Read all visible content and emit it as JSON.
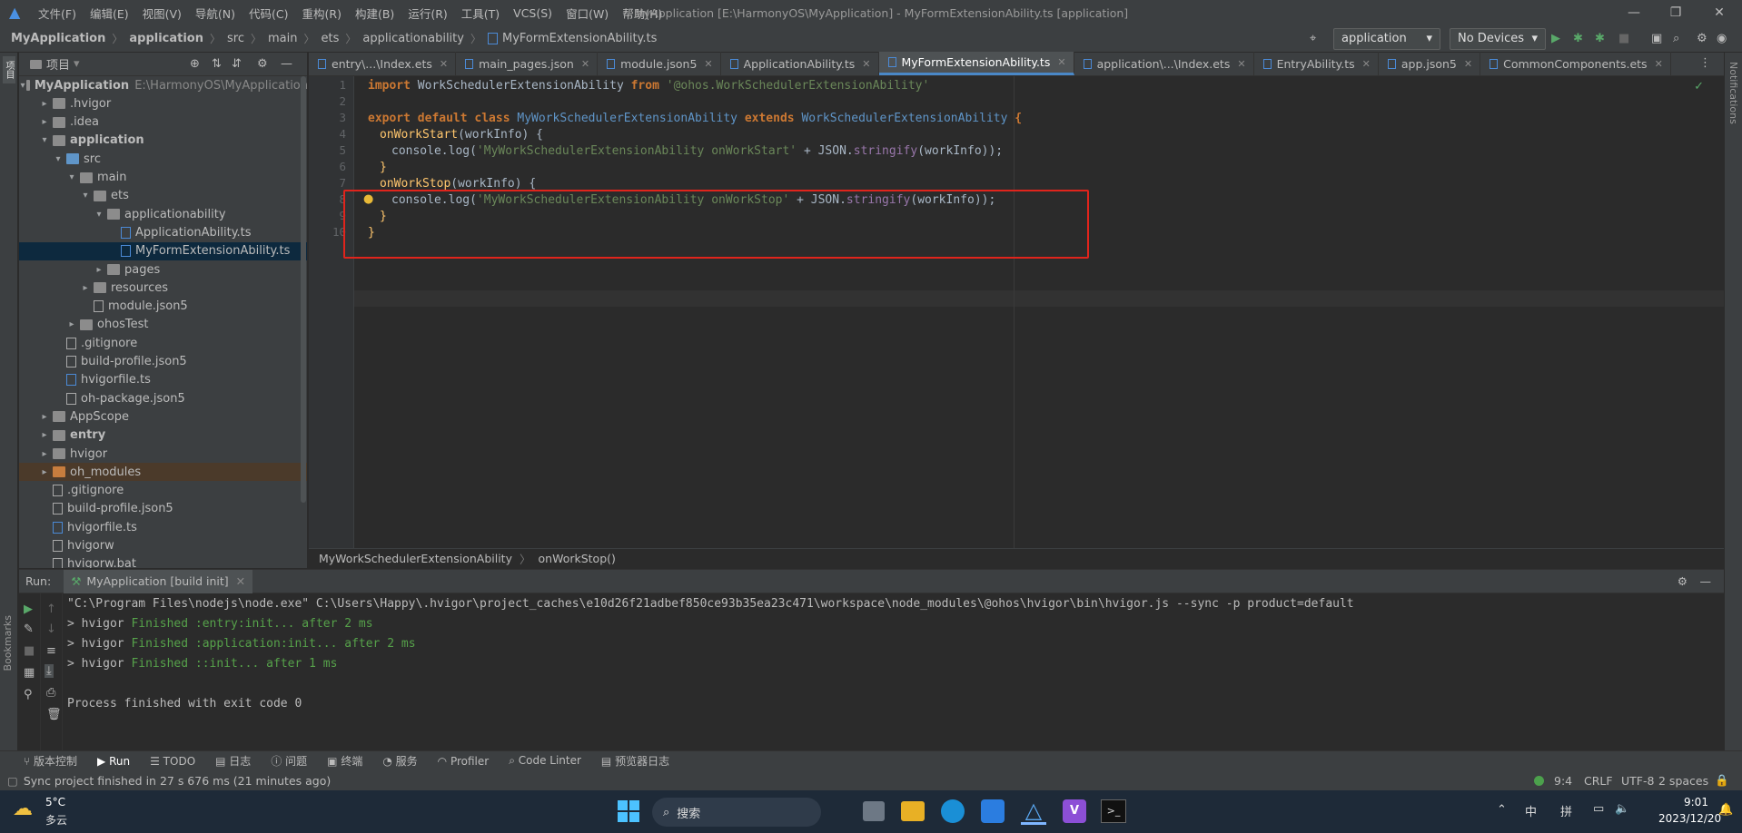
{
  "menubar": {
    "items": [
      "文件(F)",
      "编辑(E)",
      "视图(V)",
      "导航(N)",
      "代码(C)",
      "重构(R)",
      "构建(B)",
      "运行(R)",
      "工具(T)",
      "VCS(S)",
      "窗口(W)",
      "帮助(H)"
    ],
    "title": "MyApplication [E:\\HarmonyOS\\MyApplication] - MyFormExtensionAbility.ts [application]"
  },
  "navbar": {
    "crumbs": [
      "MyApplication",
      "application",
      "src",
      "main",
      "ets",
      "applicationability",
      "MyFormExtensionAbility.ts"
    ],
    "run_config": "application",
    "device": "No Devices"
  },
  "project": {
    "header": "项目",
    "rows": [
      {
        "label": "MyApplication",
        "extra": "E:\\HarmonyOS\\MyApplication",
        "indent": 0,
        "arrow": "open",
        "icon": "folder",
        "bold": true
      },
      {
        "label": ".hvigor",
        "indent": 1,
        "arrow": "closed",
        "icon": "folder"
      },
      {
        "label": ".idea",
        "indent": 1,
        "arrow": "closed",
        "icon": "folder"
      },
      {
        "label": "application",
        "indent": 1,
        "arrow": "open",
        "icon": "folder",
        "bold": true
      },
      {
        "label": "src",
        "indent": 2,
        "arrow": "open",
        "icon": "folder"
      },
      {
        "label": "main",
        "indent": 3,
        "arrow": "open",
        "icon": "folder"
      },
      {
        "label": "ets",
        "indent": 4,
        "arrow": "open",
        "icon": "folder"
      },
      {
        "label": "applicationability",
        "indent": 5,
        "arrow": "open",
        "icon": "folder"
      },
      {
        "label": "ApplicationAbility.ts",
        "indent": 6,
        "arrow": "",
        "icon": "ts"
      },
      {
        "label": "MyFormExtensionAbility.ts",
        "indent": 6,
        "arrow": "",
        "icon": "ts",
        "selected": true
      },
      {
        "label": "pages",
        "indent": 5,
        "arrow": "closed",
        "icon": "folder"
      },
      {
        "label": "resources",
        "indent": 4,
        "arrow": "closed",
        "icon": "folder"
      },
      {
        "label": "module.json5",
        "indent": 4,
        "arrow": "",
        "icon": "json"
      },
      {
        "label": "ohosTest",
        "indent": 3,
        "arrow": "closed",
        "icon": "folder"
      },
      {
        "label": ".gitignore",
        "indent": 2,
        "arrow": "",
        "icon": "json"
      },
      {
        "label": "build-profile.json5",
        "indent": 2,
        "arrow": "",
        "icon": "json"
      },
      {
        "label": "hvigorfile.ts",
        "indent": 2,
        "arrow": "",
        "icon": "ts"
      },
      {
        "label": "oh-package.json5",
        "indent": 2,
        "arrow": "",
        "icon": "json"
      },
      {
        "label": "AppScope",
        "indent": 1,
        "arrow": "closed",
        "icon": "folder"
      },
      {
        "label": "entry",
        "indent": 1,
        "arrow": "closed",
        "icon": "folder",
        "bold": true
      },
      {
        "label": "hvigor",
        "indent": 1,
        "arrow": "closed",
        "icon": "folder"
      },
      {
        "label": "oh_modules",
        "indent": 1,
        "arrow": "closed",
        "icon": "orange",
        "ohm": true
      },
      {
        "label": ".gitignore",
        "indent": 1,
        "arrow": "",
        "icon": "json"
      },
      {
        "label": "build-profile.json5",
        "indent": 1,
        "arrow": "",
        "icon": "json"
      },
      {
        "label": "hvigorfile.ts",
        "indent": 1,
        "arrow": "",
        "icon": "ts"
      },
      {
        "label": "hvigorw",
        "indent": 1,
        "arrow": "",
        "icon": "json"
      },
      {
        "label": "hvigorw.bat",
        "indent": 1,
        "arrow": "",
        "icon": "json"
      }
    ]
  },
  "tabs": [
    {
      "label": "entry\\...\\Index.ets"
    },
    {
      "label": "main_pages.json"
    },
    {
      "label": "module.json5"
    },
    {
      "label": "ApplicationAbility.ts"
    },
    {
      "label": "MyFormExtensionAbility.ts",
      "active": true
    },
    {
      "label": "application\\...\\Index.ets"
    },
    {
      "label": "EntryAbility.ts"
    },
    {
      "label": "app.json5"
    },
    {
      "label": "CommonComponents.ets"
    }
  ],
  "code": {
    "line_numbers": [
      "1",
      "2",
      "3",
      "4",
      "5",
      "6",
      "7",
      "8",
      "9",
      "10"
    ],
    "import_kw": "import",
    "import_name": " WorkSchedulerExtensionAbility ",
    "from_kw": "from",
    "import_str": " '@ohos.WorkSchedulerExtensionAbility'",
    "export_kw": "export default class",
    "class_name": " MyWorkSchedulerExtensionAbility ",
    "extends_kw": "extends",
    "base_class": " WorkSchedulerExtensionAbility ",
    "brace_open": "{",
    "m1": "onWorkStart",
    "m1_params": "(workInfo) {",
    "l5_a": "console.log(",
    "l5_str": "'MyWorkSchedulerExtensionAbility onWorkStart'",
    "l5_b": " + JSON.",
    "l5_fn": "stringify",
    "l5_c": "(workInfo));",
    "close6": "}",
    "m2": "onWorkStop",
    "m2_params": "(workInfo) {",
    "l8_a": "console.log(",
    "l8_str": "'MyWorkSchedulerExtensionAbility onWorkStop'",
    "l8_b": " + JSON.",
    "l8_fn": "stringify",
    "l8_c": "(workInfo));",
    "close9": "}",
    "close10": "}"
  },
  "editor_breadcrumb": [
    "MyWorkSchedulerExtensionAbility",
    "onWorkStop()"
  ],
  "run": {
    "label": "Run:",
    "tab": "MyApplication [build init]",
    "cmd": "\"C:\\Program Files\\nodejs\\node.exe\" C:\\Users\\Happy\\.hvigor\\project_caches\\e10d26f21adbef850ce93b35ea23c471\\workspace\\node_modules\\@ohos\\hvigor\\bin\\hvigor.js --sync -p product=default",
    "lines": [
      {
        "prefix": "> hvigor ",
        "text": "Finished :entry:init... after 2 ms"
      },
      {
        "prefix": "> hvigor ",
        "text": "Finished :application:init... after 2 ms"
      },
      {
        "prefix": "> hvigor ",
        "text": "Finished ::init... after 1 ms"
      }
    ],
    "exit": "Process finished with exit code 0"
  },
  "bottom_tabs": [
    "版本控制",
    "Run",
    "TODO",
    "日志",
    "问题",
    "终端",
    "服务",
    "Profiler",
    "Code Linter",
    "预览器日志"
  ],
  "status": {
    "message": "Sync project finished in 27 s 676 ms (21 minutes ago)",
    "position": "9:4",
    "line_sep": "CRLF",
    "encoding": "UTF-8",
    "indent": "2 spaces"
  },
  "side": {
    "bookmarks": "Bookmarks",
    "notifications": "Notifications"
  },
  "taskbar": {
    "temp": "5°C",
    "weather": "多云",
    "search": "搜索",
    "ime1": "中",
    "ime2": "拼",
    "time": "9:01",
    "date": "2023/12/20"
  }
}
